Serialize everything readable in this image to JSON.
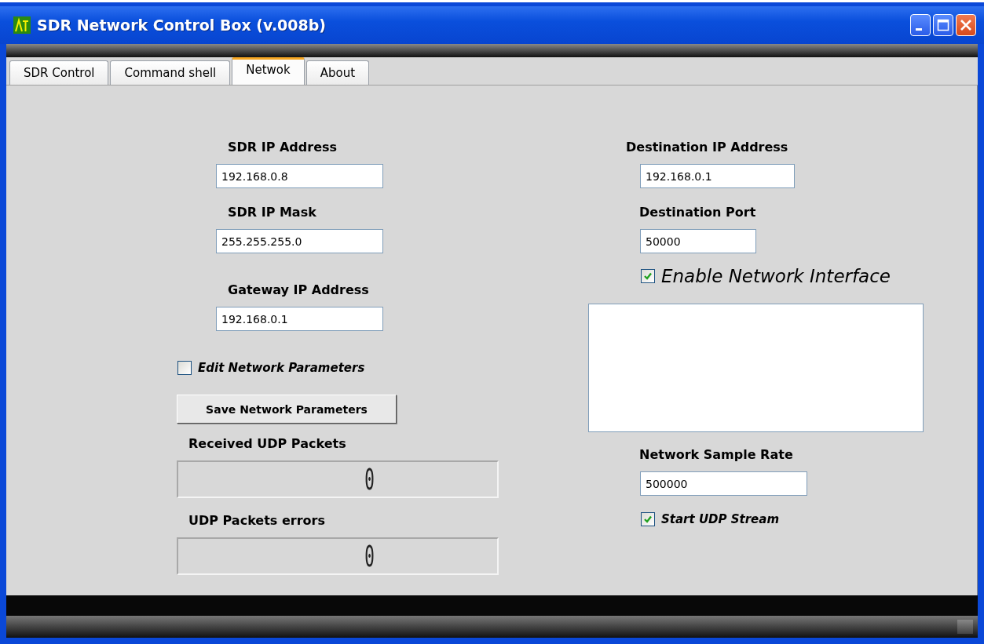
{
  "window": {
    "title": "SDR Network Control Box (v.008b)"
  },
  "tabs": [
    {
      "label": "SDR Control",
      "selected": false
    },
    {
      "label": "Command shell",
      "selected": false
    },
    {
      "label": "Netwok",
      "selected": true
    },
    {
      "label": "About",
      "selected": false
    }
  ],
  "left_column": [
    {
      "kind": "label",
      "text": "SDR IP Address"
    },
    {
      "kind": "field",
      "value": "192.168.0.8"
    },
    {
      "kind": "label",
      "text": "SDR IP Mask"
    },
    {
      "kind": "field",
      "value": "255.255.255.0"
    },
    {
      "kind": "label",
      "text": "Gateway IP Address"
    },
    {
      "kind": "field",
      "value": "192.168.0.1"
    },
    {
      "kind": "checkbox",
      "label": "Edit Network Parameters",
      "checked": false
    },
    {
      "kind": "button",
      "label": "Save Network Parameters"
    },
    {
      "kind": "label",
      "text": "Received UDP Packets"
    },
    {
      "kind": "counter",
      "value": "0"
    },
    {
      "kind": "label",
      "text": "UDP Packets errors"
    },
    {
      "kind": "counter",
      "value": "0"
    }
  ],
  "right_column": [
    {
      "kind": "label",
      "text": "Destination IP Address"
    },
    {
      "kind": "field",
      "value": "192.168.0.1"
    },
    {
      "kind": "label",
      "text": "Destination Port"
    },
    {
      "kind": "field",
      "value": "50000"
    },
    {
      "kind": "checkbox",
      "label": "Enable Network Interface",
      "checked": true
    },
    {
      "kind": "textbox"
    },
    {
      "kind": "label",
      "text": "Network Sample Rate"
    },
    {
      "kind": "field",
      "value": "500000"
    },
    {
      "kind": "checkbox",
      "label": "Start UDP Stream",
      "checked": true
    }
  ]
}
